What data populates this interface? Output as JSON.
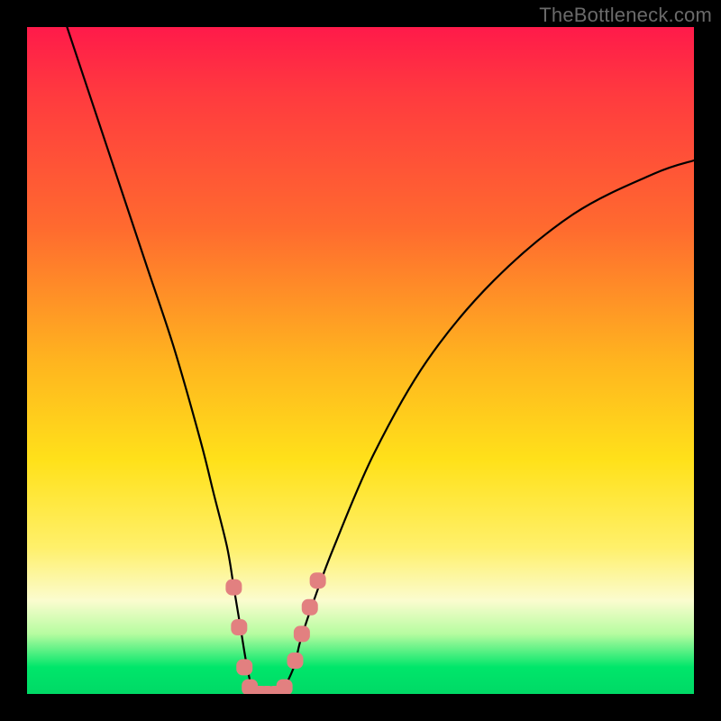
{
  "watermark": "TheBottleneck.com",
  "chart_data": {
    "type": "line",
    "title": "",
    "xlabel": "",
    "ylabel": "",
    "ylim": [
      0,
      100
    ],
    "xlim": [
      0,
      100
    ],
    "series": [
      {
        "name": "bottleneck-curve",
        "x": [
          6,
          10,
          14,
          18,
          22,
          26,
          28,
          30,
          31,
          32,
          33,
          34,
          35,
          36,
          37,
          38,
          40,
          41,
          43,
          46,
          52,
          60,
          70,
          82,
          94,
          100
        ],
        "y": [
          100,
          88,
          76,
          64,
          52,
          38,
          30,
          22,
          16,
          10,
          4,
          0,
          0,
          0,
          0,
          0,
          4,
          8,
          14,
          22,
          36,
          50,
          62,
          72,
          78,
          80
        ]
      }
    ],
    "markers": {
      "name": "highlighted-points",
      "color": "#e28080",
      "points": [
        {
          "x": 31.0,
          "y": 16
        },
        {
          "x": 31.8,
          "y": 10
        },
        {
          "x": 32.6,
          "y": 4
        },
        {
          "x": 33.4,
          "y": 1
        },
        {
          "x": 34.2,
          "y": 0
        },
        {
          "x": 35.0,
          "y": 0
        },
        {
          "x": 36.0,
          "y": 0
        },
        {
          "x": 37.2,
          "y": 0
        },
        {
          "x": 38.6,
          "y": 1
        },
        {
          "x": 40.2,
          "y": 5
        },
        {
          "x": 41.2,
          "y": 9
        },
        {
          "x": 42.4,
          "y": 13
        },
        {
          "x": 43.6,
          "y": 17
        }
      ]
    },
    "gradient_stops": [
      {
        "pos": 0,
        "color": "#ff1a4a"
      },
      {
        "pos": 50,
        "color": "#ffb41f"
      },
      {
        "pos": 78,
        "color": "#fff06a"
      },
      {
        "pos": 100,
        "color": "#00d966"
      }
    ]
  }
}
